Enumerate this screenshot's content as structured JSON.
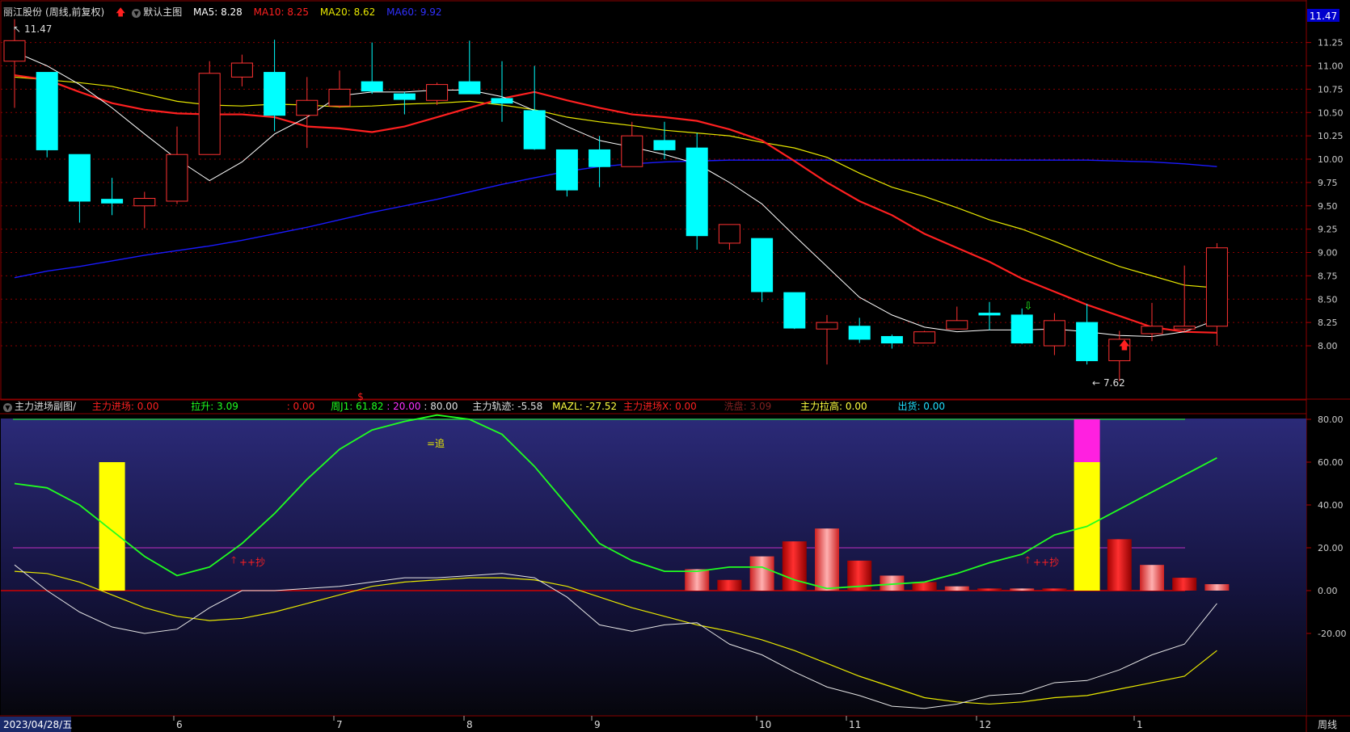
{
  "header": {
    "stock_name": "丽江股份",
    "period": "(周线,前复权)",
    "main_chart_label": "默认主图",
    "ma5": "MA5: 8.28",
    "ma10": "MA10: 8.25",
    "ma20": "MA20: 8.62",
    "ma60": "MA60: 9.92"
  },
  "indicator_header": {
    "name": "主力进场副图/",
    "items": [
      {
        "text": "主力进场: 0.00",
        "color": "#ff2020"
      },
      {
        "text": "拉升: 3.09",
        "color": "#20ff20"
      },
      {
        "text": ": 0.00",
        "color": "#ff2020"
      },
      {
        "text": "周J1: 61.82",
        "color": "#20ff20"
      },
      {
        "text": ": 20.00",
        "color": "#ff30ff"
      },
      {
        "text": ": 80.00",
        "color": "#e0e0e0"
      },
      {
        "text": "主力轨迹: -5.58",
        "color": "#e0e0e0"
      },
      {
        "text": "MAZL: -27.52",
        "color": "#ffff40"
      },
      {
        "text": "主力进场X: 0.00",
        "color": "#ff2020"
      },
      {
        "text": "洗盘: 3.09",
        "color": "#802020"
      },
      {
        "text": "主力拉高: 0.00",
        "color": "#ffff40"
      },
      {
        "text": "出货: 0.00",
        "color": "#20e0ff"
      }
    ]
  },
  "colors": {
    "up": "#ff3232",
    "down": "#00ffff",
    "ma5": "#ffffff",
    "ma10": "#ff2020",
    "ma20": "#e8e800",
    "ma60": "#1a1aff",
    "background": "#000000",
    "grid": "#8b0000"
  },
  "price_axis": {
    "ticks": [
      "11.25",
      "11.00",
      "10.75",
      "10.50",
      "10.25",
      "10.00",
      "9.75",
      "9.50",
      "9.25",
      "9.00",
      "8.75",
      "8.50",
      "8.25",
      "8.00"
    ],
    "current": "11.47",
    "high_label": "11.47",
    "low_label": "7.62"
  },
  "indicator_axis": {
    "ticks": [
      "80.00",
      "60.00",
      "40.00",
      "20.00",
      "0.00",
      "-20.00"
    ]
  },
  "date_axis": {
    "start": "2023/04/28/五",
    "months": [
      "6",
      "7",
      "8",
      "9",
      "10",
      "11",
      "12",
      "1"
    ],
    "period_label": "周线"
  },
  "annotations": {
    "dollar": "$",
    "chase": "=追",
    "buy1": "++抄",
    "buy2": "++抄"
  },
  "chart_data": {
    "type": "candlestick",
    "candles": [
      {
        "o": 11.05,
        "h": 11.5,
        "l": 10.55,
        "c": 11.27
      },
      {
        "o": 10.93,
        "h": 10.93,
        "l": 10.02,
        "c": 10.1
      },
      {
        "o": 10.05,
        "h": 10.05,
        "l": 9.32,
        "c": 9.55
      },
      {
        "o": 9.57,
        "h": 9.8,
        "l": 9.4,
        "c": 9.53
      },
      {
        "o": 9.5,
        "h": 9.65,
        "l": 9.26,
        "c": 9.58
      },
      {
        "o": 9.55,
        "h": 10.35,
        "l": 9.52,
        "c": 10.05
      },
      {
        "o": 10.05,
        "h": 11.05,
        "l": 10.05,
        "c": 10.92
      },
      {
        "o": 10.88,
        "h": 11.12,
        "l": 10.78,
        "c": 11.03
      },
      {
        "o": 10.93,
        "h": 11.28,
        "l": 10.3,
        "c": 10.47
      },
      {
        "o": 10.47,
        "h": 10.88,
        "l": 10.12,
        "c": 10.63
      },
      {
        "o": 10.57,
        "h": 10.95,
        "l": 10.55,
        "c": 10.75
      },
      {
        "o": 10.83,
        "h": 11.25,
        "l": 10.7,
        "c": 10.73
      },
      {
        "o": 10.7,
        "h": 10.72,
        "l": 10.48,
        "c": 10.64
      },
      {
        "o": 10.63,
        "h": 10.82,
        "l": 10.58,
        "c": 10.8
      },
      {
        "o": 10.83,
        "h": 11.27,
        "l": 10.7,
        "c": 10.7
      },
      {
        "o": 10.65,
        "h": 11.05,
        "l": 10.4,
        "c": 10.6
      },
      {
        "o": 10.52,
        "h": 11.0,
        "l": 10.1,
        "c": 10.11
      },
      {
        "o": 10.1,
        "h": 10.1,
        "l": 9.6,
        "c": 9.67
      },
      {
        "o": 10.1,
        "h": 10.25,
        "l": 9.7,
        "c": 9.92
      },
      {
        "o": 9.92,
        "h": 10.4,
        "l": 9.92,
        "c": 10.25
      },
      {
        "o": 10.2,
        "h": 10.4,
        "l": 10.0,
        "c": 10.1
      },
      {
        "o": 10.12,
        "h": 10.28,
        "l": 9.03,
        "c": 9.18
      },
      {
        "o": 9.1,
        "h": 9.3,
        "l": 9.03,
        "c": 9.3
      },
      {
        "o": 9.15,
        "h": 9.15,
        "l": 8.47,
        "c": 8.58
      },
      {
        "o": 8.57,
        "h": 8.57,
        "l": 8.18,
        "c": 8.19
      },
      {
        "o": 8.18,
        "h": 8.33,
        "l": 7.8,
        "c": 8.25
      },
      {
        "o": 8.21,
        "h": 8.3,
        "l": 8.03,
        "c": 8.07
      },
      {
        "o": 8.1,
        "h": 8.12,
        "l": 7.97,
        "c": 8.03
      },
      {
        "o": 8.03,
        "h": 8.16,
        "l": 8.03,
        "c": 8.15
      },
      {
        "o": 8.18,
        "h": 8.42,
        "l": 8.18,
        "c": 8.27
      },
      {
        "o": 8.35,
        "h": 8.47,
        "l": 8.17,
        "c": 8.33
      },
      {
        "o": 8.33,
        "h": 8.4,
        "l": 8.02,
        "c": 8.03
      },
      {
        "o": 8.0,
        "h": 8.35,
        "l": 7.9,
        "c": 8.27
      },
      {
        "o": 8.25,
        "h": 8.45,
        "l": 7.8,
        "c": 7.84
      },
      {
        "o": 7.84,
        "h": 8.16,
        "l": 7.62,
        "c": 8.07
      },
      {
        "o": 8.13,
        "h": 8.46,
        "l": 8.05,
        "c": 8.21
      },
      {
        "o": 8.18,
        "h": 8.86,
        "l": 8.15,
        "c": 8.21
      },
      {
        "o": 8.21,
        "h": 9.1,
        "l": 8.0,
        "c": 9.05
      }
    ],
    "ma5": [
      11.15,
      11.0,
      10.8,
      10.55,
      10.27,
      10.0,
      9.77,
      9.97,
      10.27,
      10.45,
      10.68,
      10.72,
      10.72,
      10.74,
      10.74,
      10.67,
      10.52,
      10.35,
      10.2,
      10.13,
      10.05,
      9.95,
      9.75,
      9.52,
      9.18,
      8.85,
      8.52,
      8.33,
      8.2,
      8.15,
      8.17,
      8.17,
      8.18,
      8.15,
      8.11,
      8.1,
      8.15,
      8.28
    ],
    "ma10": [
      10.9,
      10.85,
      10.72,
      10.6,
      10.53,
      10.49,
      10.48,
      10.48,
      10.45,
      10.35,
      10.33,
      10.29,
      10.35,
      10.45,
      10.55,
      10.65,
      10.72,
      10.63,
      10.55,
      10.48,
      10.45,
      10.41,
      10.32,
      10.2,
      9.98,
      9.75,
      9.55,
      9.4,
      9.2,
      9.05,
      8.9,
      8.72,
      8.58,
      8.44,
      8.32,
      8.2,
      8.15,
      8.14,
      8.12,
      8.16,
      8.25
    ],
    "ma20": [
      10.88,
      10.85,
      10.82,
      10.78,
      10.7,
      10.62,
      10.58,
      10.57,
      10.59,
      10.58,
      10.56,
      10.57,
      10.59,
      10.6,
      10.62,
      10.58,
      10.53,
      10.45,
      10.4,
      10.36,
      10.31,
      10.28,
      10.25,
      10.18,
      10.12,
      10.02,
      9.85,
      9.7,
      9.6,
      9.48,
      9.35,
      9.25,
      9.12,
      8.98,
      8.85,
      8.75,
      8.65,
      8.62
    ],
    "ma60": [
      8.73,
      8.8,
      8.85,
      8.91,
      8.97,
      9.02,
      9.07,
      9.13,
      9.2,
      9.27,
      9.35,
      9.43,
      9.5,
      9.57,
      9.65,
      9.73,
      9.8,
      9.87,
      9.92,
      9.95,
      9.97,
      9.98,
      9.99,
      9.99,
      9.99,
      9.99,
      9.99,
      9.99,
      9.99,
      9.99,
      9.99,
      9.99,
      9.99,
      9.99,
      9.98,
      9.97,
      9.95,
      9.92
    ],
    "indicator": {
      "green_line": [
        50,
        48,
        40,
        28,
        16,
        7,
        11,
        22,
        36,
        52,
        66,
        75,
        79,
        82,
        80,
        73,
        58,
        40,
        22,
        14,
        9,
        9,
        11,
        11,
        5,
        1,
        2,
        3,
        4,
        8,
        13,
        17,
        26,
        30,
        38,
        46,
        54,
        62
      ],
      "white_line": [
        12,
        0,
        -10,
        -17,
        -20,
        -18,
        -8,
        0,
        0,
        1,
        2,
        4,
        6,
        6,
        7,
        8,
        6,
        -3,
        -16,
        -19,
        -16,
        -15,
        -25,
        -30,
        -38,
        -45,
        -49,
        -54,
        -55,
        -53,
        -49,
        -48,
        -43,
        -42,
        -37,
        -30,
        -25,
        -6
      ],
      "yellow_line": [
        9,
        8,
        4,
        -2,
        -8,
        -12,
        -14,
        -13,
        -10,
        -6,
        -2,
        2,
        4,
        5,
        6,
        6,
        5,
        2,
        -3,
        -8,
        -12,
        -16,
        -19,
        -23,
        -28,
        -34,
        -40,
        -45,
        -50,
        -52,
        -53,
        -52,
        -50,
        -49,
        -46,
        -43,
        -40,
        -28
      ],
      "red_bars": [
        0,
        0,
        0,
        0,
        0,
        0,
        0,
        0,
        0,
        0,
        0,
        0,
        0,
        0,
        0,
        0,
        0,
        0,
        0,
        0,
        0,
        10,
        5,
        16,
        23,
        29,
        14,
        7,
        4,
        2,
        1,
        1,
        1,
        0,
        24,
        12,
        6,
        3
      ],
      "yellow_bars": [
        0,
        0,
        0,
        60,
        0,
        0,
        0,
        0,
        0,
        0,
        0,
        0,
        0,
        0,
        0,
        0,
        0,
        0,
        0,
        0,
        0,
        0,
        0,
        0,
        0,
        0,
        0,
        0,
        0,
        0,
        0,
        0,
        0,
        60,
        0,
        0,
        0,
        0
      ],
      "magenta_bars": [
        0,
        0,
        0,
        0,
        0,
        0,
        0,
        0,
        0,
        0,
        0,
        0,
        0,
        0,
        0,
        0,
        0,
        0,
        0,
        0,
        0,
        0,
        0,
        0,
        0,
        0,
        0,
        0,
        0,
        0,
        0,
        0,
        0,
        20,
        0,
        0,
        0,
        0
      ],
      "levels": [
        80,
        20,
        0
      ]
    }
  }
}
